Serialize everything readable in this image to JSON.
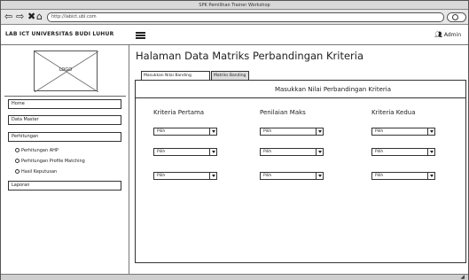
{
  "browser": {
    "window_title": "SPK Pemilihan Trainer Workshop",
    "url": "http://labict.ubl.com",
    "nav_icons": {
      "back": "back-arrow-icon",
      "forward": "forward-arrow-icon",
      "stop": "close-icon",
      "home": "home-icon",
      "search": "search-icon"
    }
  },
  "header": {
    "brand": "LAB ICT UNIVERSITAS BUDI LUHUR",
    "menu_icon": "hamburger-icon",
    "user_icon": "users-icon",
    "user_label": "Admin"
  },
  "sidebar": {
    "logo_label": "LOGO",
    "items": [
      {
        "label": "Home"
      },
      {
        "label": "Data Master"
      },
      {
        "label": "Perhitungan"
      },
      {
        "label": "Laporan"
      }
    ],
    "subitems": [
      {
        "label": "Perhitungan AHP"
      },
      {
        "label": "Perhitungan Profile Matching"
      },
      {
        "label": "Hasil Keputusan"
      }
    ]
  },
  "main": {
    "title": "Halaman Data Matriks Perbandingan Kriteria",
    "tabs": [
      {
        "label": "Masukkan Nilai Banding"
      },
      {
        "label": "Matriks Banding"
      }
    ],
    "panel_title": "Masukkan Nilai Perbandingan Kriteria",
    "columns": [
      "Kriteria Pertama",
      "Penilaian Maks",
      "Kriteria Kedua"
    ],
    "rows": [
      [
        "Pilih",
        "Pilih",
        "Pilih"
      ],
      [
        "Pilih",
        "Pilih",
        "Pilih"
      ],
      [
        "Pilih",
        "Pilih",
        "Pilih"
      ]
    ]
  }
}
